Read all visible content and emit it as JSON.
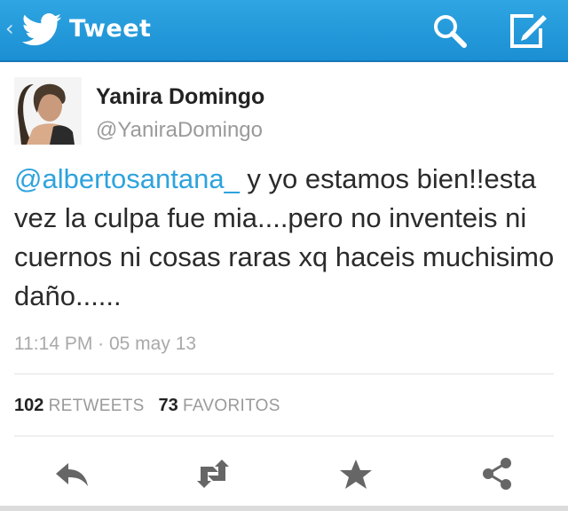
{
  "header": {
    "back_glyph": "‹",
    "title": "Tweet",
    "bird_icon": "twitter-bird-icon",
    "search_icon": "search-icon",
    "compose_icon": "compose-icon",
    "background": "#1f96d8"
  },
  "tweet": {
    "author_name": "Yanira Domingo",
    "author_handle": "@YaniraDomingo",
    "mention": "@albertosantana_",
    "text_rest": " y yo estamos bien!!esta vez la culpa fue mia....pero no inventeis ni cuernos ni cosas raras xq haceis muchisimo daño......",
    "timestamp": "11:14 PM · 05 may 13",
    "mention_color": "#2ea3dd"
  },
  "stats": {
    "retweets_count": "102",
    "retweets_label": "RETWEETS",
    "favorites_count": "73",
    "favorites_label": "FAVORITOS"
  },
  "actions": [
    {
      "icon": "reply-icon"
    },
    {
      "icon": "retweet-icon"
    },
    {
      "icon": "favorite-star-icon"
    },
    {
      "icon": "share-icon"
    }
  ]
}
